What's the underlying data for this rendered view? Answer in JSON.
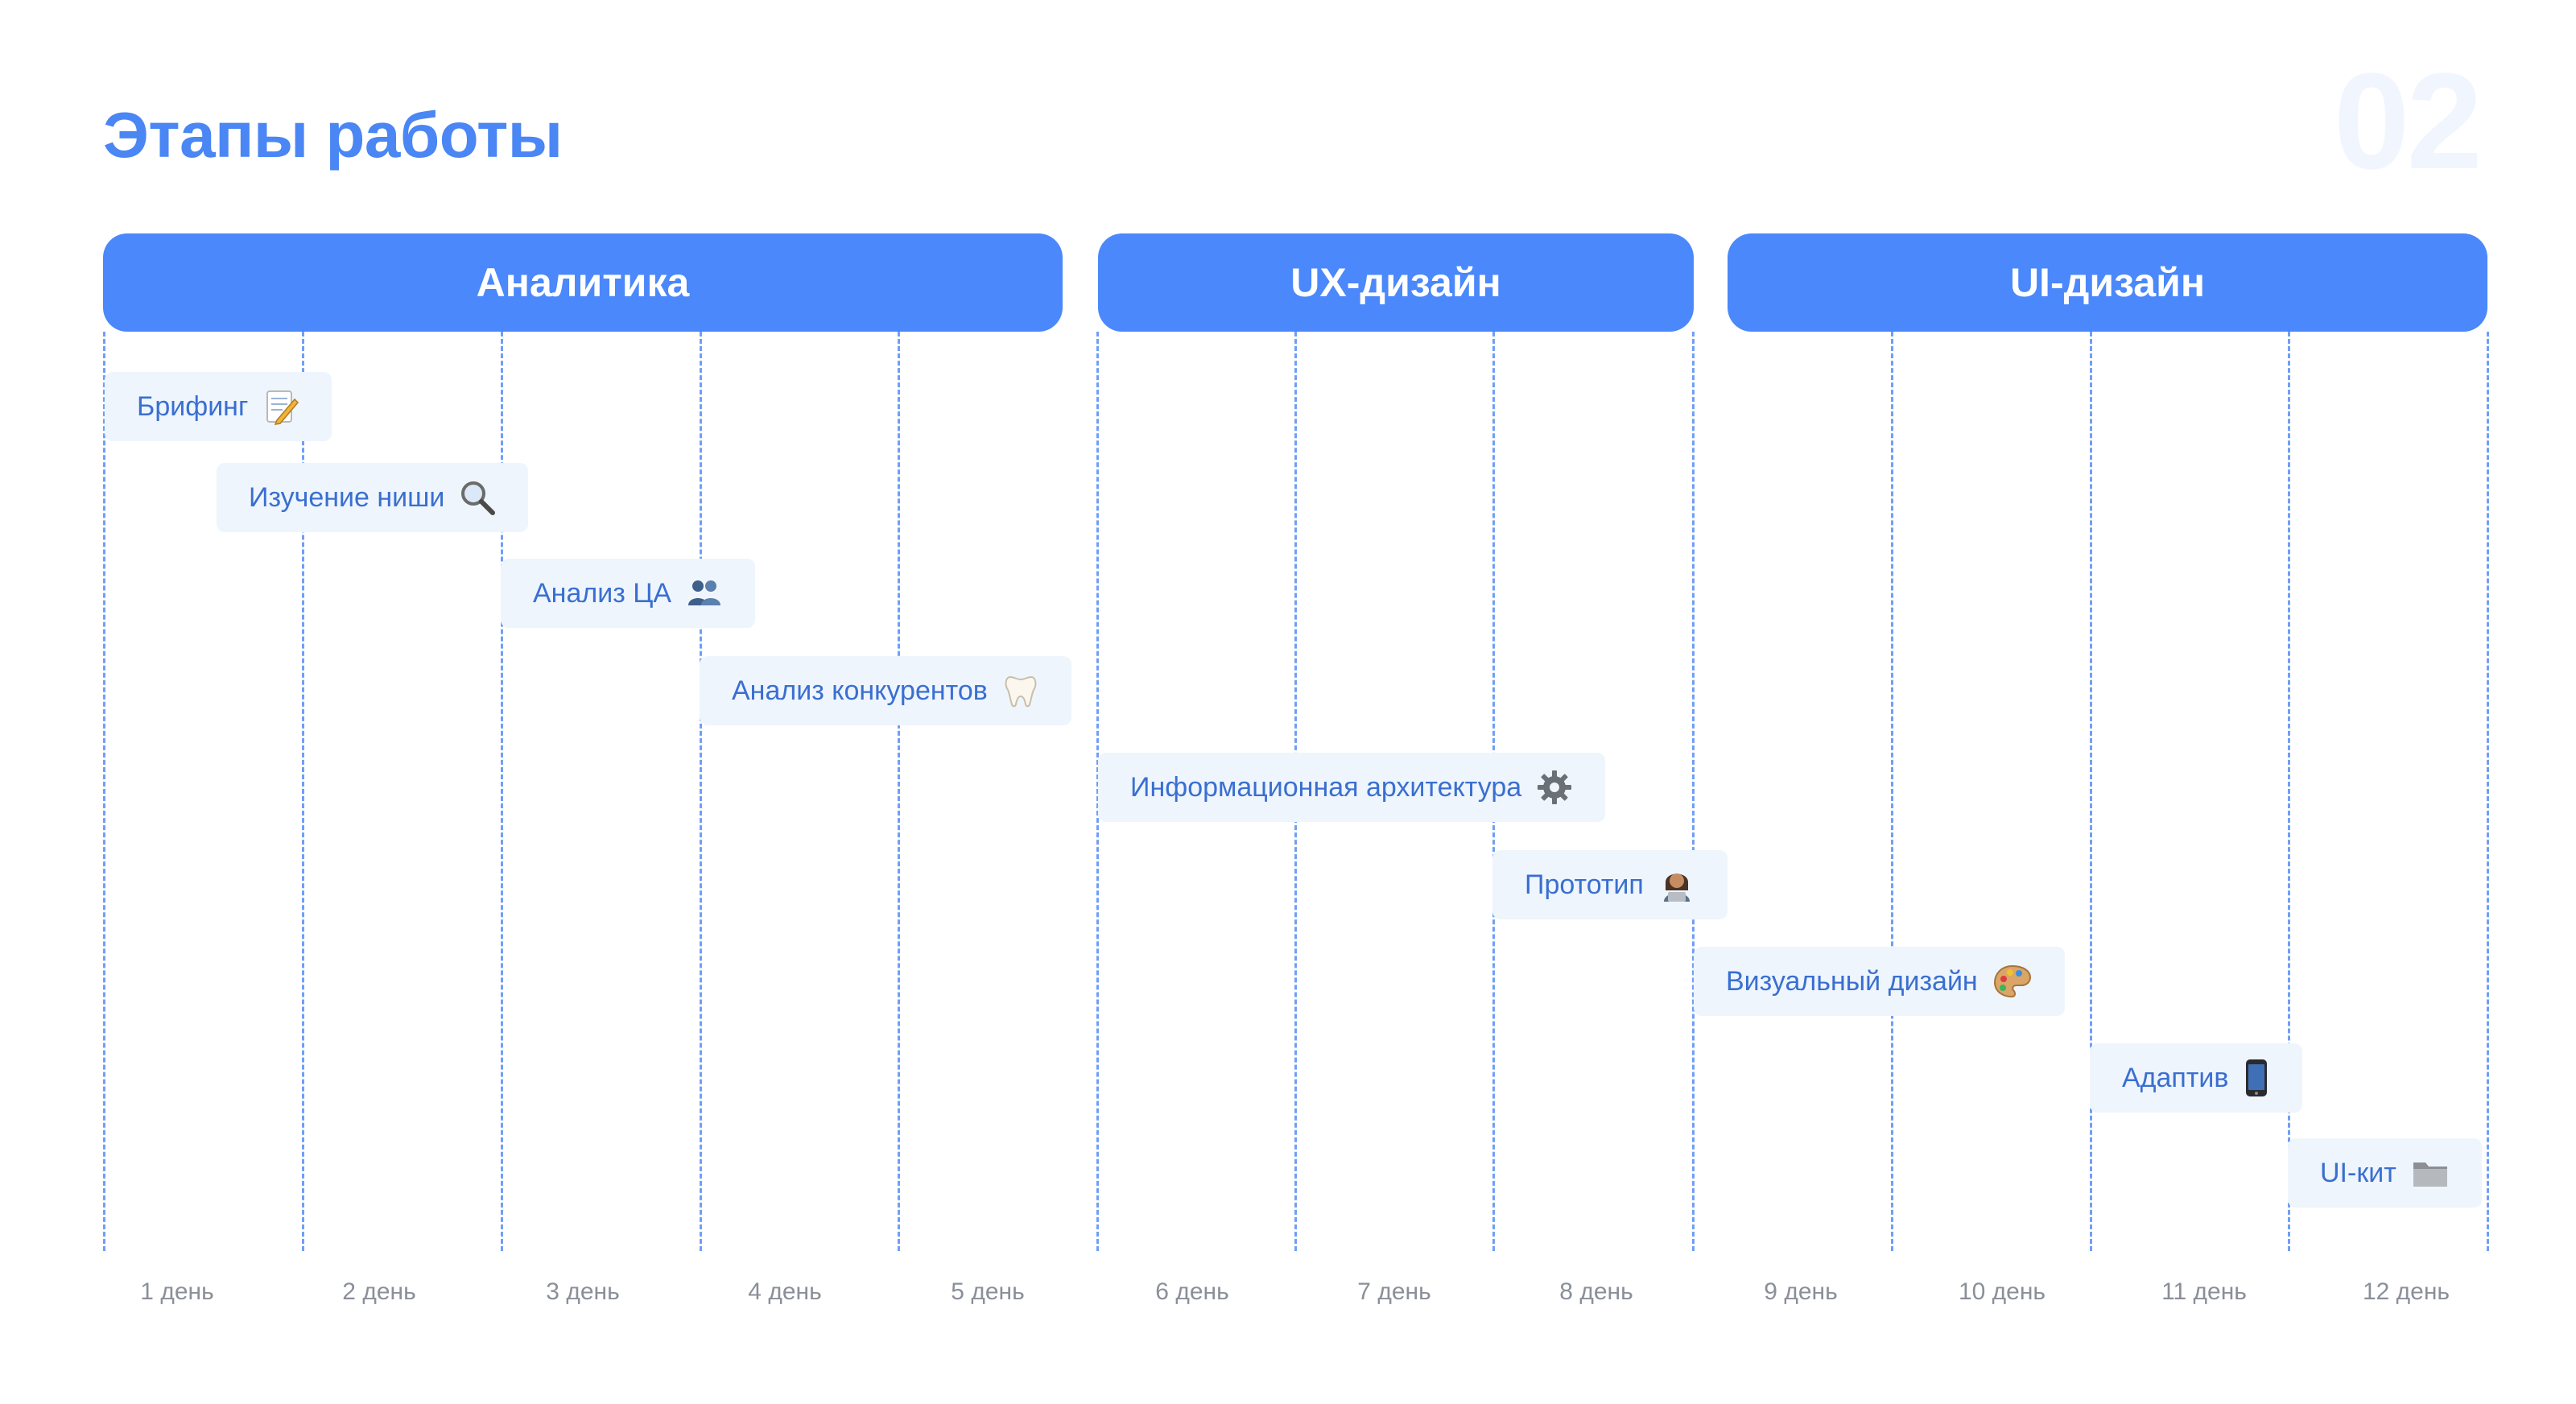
{
  "title": "Этапы работы",
  "page_number": "02",
  "phases": [
    {
      "label": "Аналитика"
    },
    {
      "label": "UX-дизайн"
    },
    {
      "label": "UI-дизайн"
    }
  ],
  "tasks": [
    {
      "label": "Брифинг",
      "icon": "memo-icon"
    },
    {
      "label": "Изучение ниши",
      "icon": "magnifier-icon"
    },
    {
      "label": "Анализ ЦА",
      "icon": "people-icon"
    },
    {
      "label": "Анализ конкурентов",
      "icon": "tooth-icon"
    },
    {
      "label": "Информационная архитектура",
      "icon": "gear-icon"
    },
    {
      "label": "Прототип",
      "icon": "person-laptop-icon"
    },
    {
      "label": "Визуальный дизайн",
      "icon": "palette-icon"
    },
    {
      "label": "Адаптив",
      "icon": "phone-icon"
    },
    {
      "label": "UI-кит",
      "icon": "folder-icon"
    }
  ],
  "days": [
    "1 день",
    "2 день",
    "3 день",
    "4 день",
    "5 день",
    "6 день",
    "7 день",
    "8 день",
    "9 день",
    "10 день",
    "11 день",
    "12 день"
  ],
  "colors": {
    "accent": "#4a88fb",
    "title": "#4a86f4",
    "task_bg": "#eef5fd",
    "task_text": "#3a6fd0",
    "grid": "#6f9ff7",
    "day_text": "#8a8f99"
  }
}
